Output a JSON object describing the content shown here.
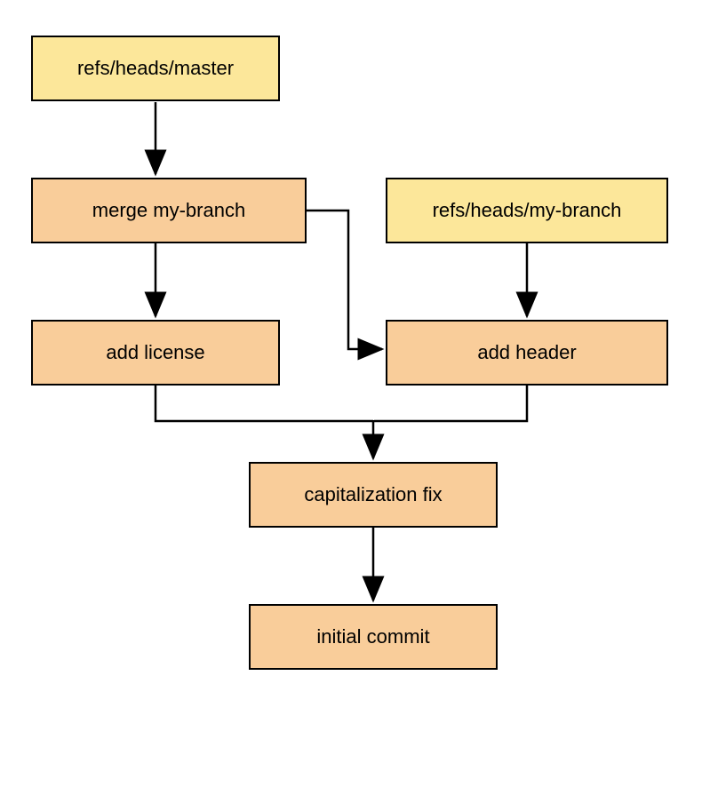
{
  "nodes": {
    "master_ref": "refs/heads/master",
    "merge": "merge my-branch",
    "my_branch_ref": "refs/heads/my-branch",
    "add_license": "add license",
    "add_header": "add header",
    "cap_fix": "capitalization fix",
    "initial": "initial commit"
  },
  "colors": {
    "ref_bg": "#fce79a",
    "commit_bg": "#f9cd9a",
    "border": "#000000"
  }
}
